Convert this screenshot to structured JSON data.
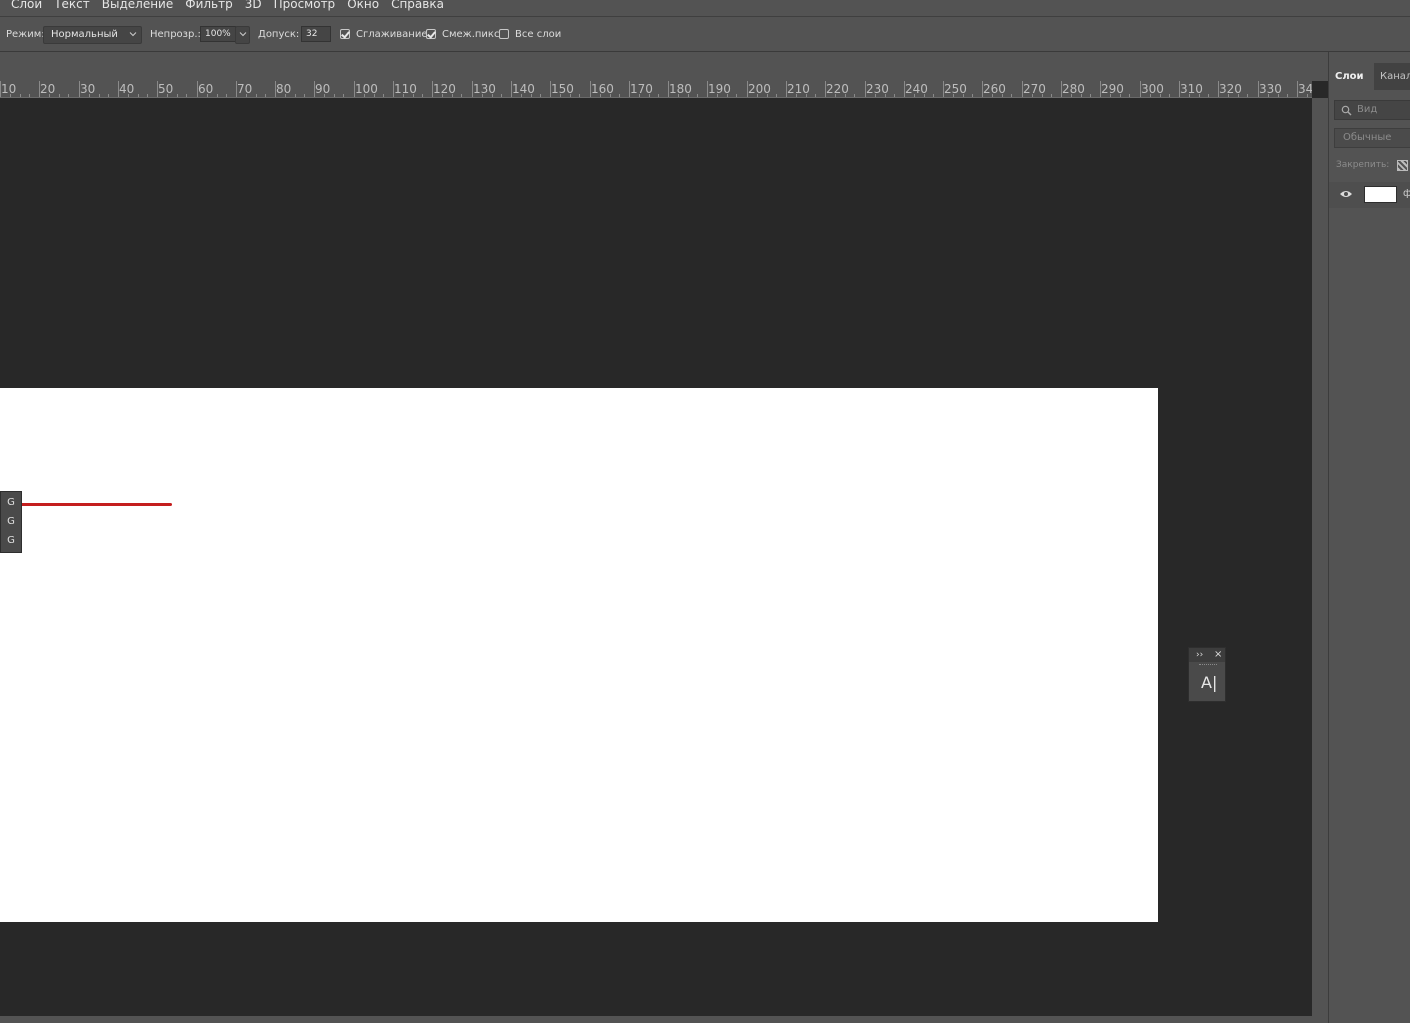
{
  "menu": {
    "items": [
      "Слои",
      "Текст",
      "Выделение",
      "Фильтр",
      "3D",
      "Просмотр",
      "Окно",
      "Справка"
    ]
  },
  "options": {
    "mode_label": "Режим:",
    "mode_value": "Нормальный",
    "opacity_label": "Непрозр.:",
    "opacity_value": "100%",
    "tolerance_label": "Допуск:",
    "tolerance_value": "32",
    "antialias_label": "Сглаживание",
    "antialias_checked": true,
    "contiguous_label": "Смеж.пикс",
    "contiguous_checked": true,
    "all_layers_label": "Все слои",
    "all_layers_checked": false
  },
  "ruler": {
    "labels": [
      "10",
      "20",
      "30",
      "40",
      "50",
      "60",
      "70",
      "80",
      "90",
      "100",
      "110",
      "120",
      "130",
      "140",
      "150",
      "160",
      "170",
      "180",
      "190",
      "200",
      "210",
      "220",
      "230",
      "240",
      "250",
      "260",
      "270",
      "280",
      "290",
      "300",
      "310",
      "320",
      "330",
      "34"
    ]
  },
  "mini_toolbar": {
    "buttons": [
      "G",
      "G",
      "G"
    ]
  },
  "glyph_panel": {
    "collapse": "››",
    "close": "×",
    "glyph": "A|"
  },
  "layers_panel": {
    "tab_layers": "Слои",
    "tab_channels": "Каналы",
    "search_placeholder": "Вид",
    "blend_mode": "Обычные",
    "lock_label": "Закрепить:",
    "layer_name": "ф"
  },
  "colors": {
    "chrome": "#535353",
    "workspace": "#282828",
    "document": "#ffffff",
    "stroke": "#c41e1e"
  }
}
